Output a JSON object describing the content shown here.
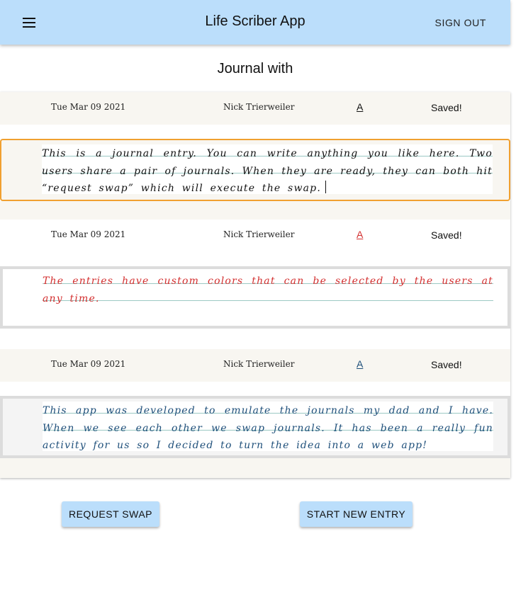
{
  "appbar": {
    "title": "Life Scriber App",
    "signout_label": "SIGN OUT",
    "menu_icon": "hamburger-menu-icon"
  },
  "journal_heading": "Journal with",
  "entries": [
    {
      "date": "Tue Mar 09 2021",
      "author": "Nick Trierweiler",
      "color_button": "A",
      "color": "#111111",
      "status": "Saved!",
      "text": "This is a journal entry. You can write anything you like here. Two users share a pair of journals. When they are ready, they can both hit “request swap” which will execute the swap."
    },
    {
      "date": "Tue Mar 09 2021",
      "author": "Nick Trierweiler",
      "color_button": "A",
      "color": "#d32f2f",
      "status": "Saved!",
      "text": "The entries have custom colors that can be selected by the users at any time."
    },
    {
      "date": "Tue Mar 09 2021",
      "author": "Nick Trierweiler",
      "color_button": "A",
      "color": "#1e4f7a",
      "status": "Saved!",
      "text": "This app was developed to emulate the journals my dad and I have. When we see each other we swap journals. It has been a really fun activity for us so I decided to turn the idea into a web app!"
    }
  ],
  "buttons": {
    "request_swap": "REQUEST SWAP",
    "start_new_entry": "START NEW ENTRY"
  },
  "colors": {
    "appbar": "#bbdefb",
    "active_border": "#f0a030",
    "paper_line": "#9cc9c4"
  }
}
